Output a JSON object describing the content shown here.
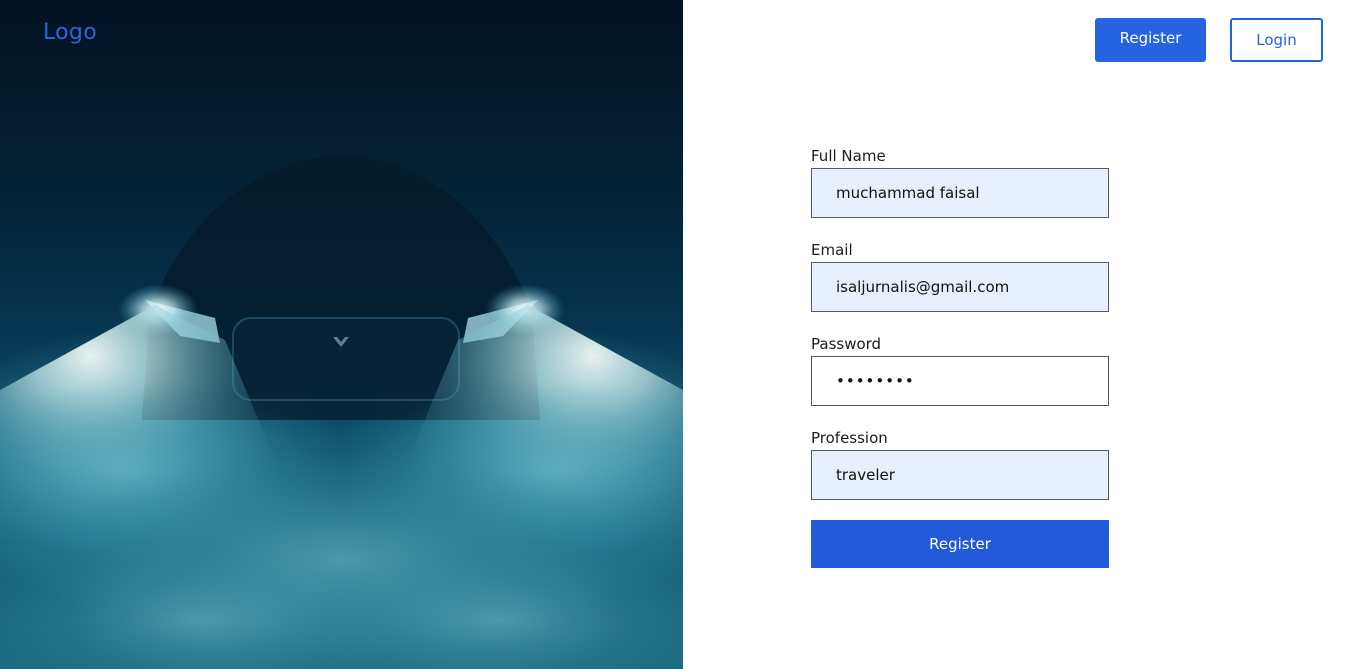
{
  "header": {
    "logo_text": "Logo",
    "register_label": "Register",
    "login_label": "Login"
  },
  "form": {
    "full_name": {
      "label": "Full Name",
      "value": "muchammad faisal"
    },
    "email": {
      "label": "Email",
      "value": "isaljurnalis@gmail.com"
    },
    "password": {
      "label": "Password",
      "value": "••••••••"
    },
    "profession": {
      "label": "Profession",
      "value": "traveler"
    },
    "submit_label": "Register"
  },
  "colors": {
    "accent": "#2563e0",
    "input_autofill_bg": "#e8f0fe",
    "hero_dark": "#032033",
    "hero_fog": "#1d6b82"
  },
  "hero": {
    "image_subject": "car-headlights-in-fog"
  }
}
